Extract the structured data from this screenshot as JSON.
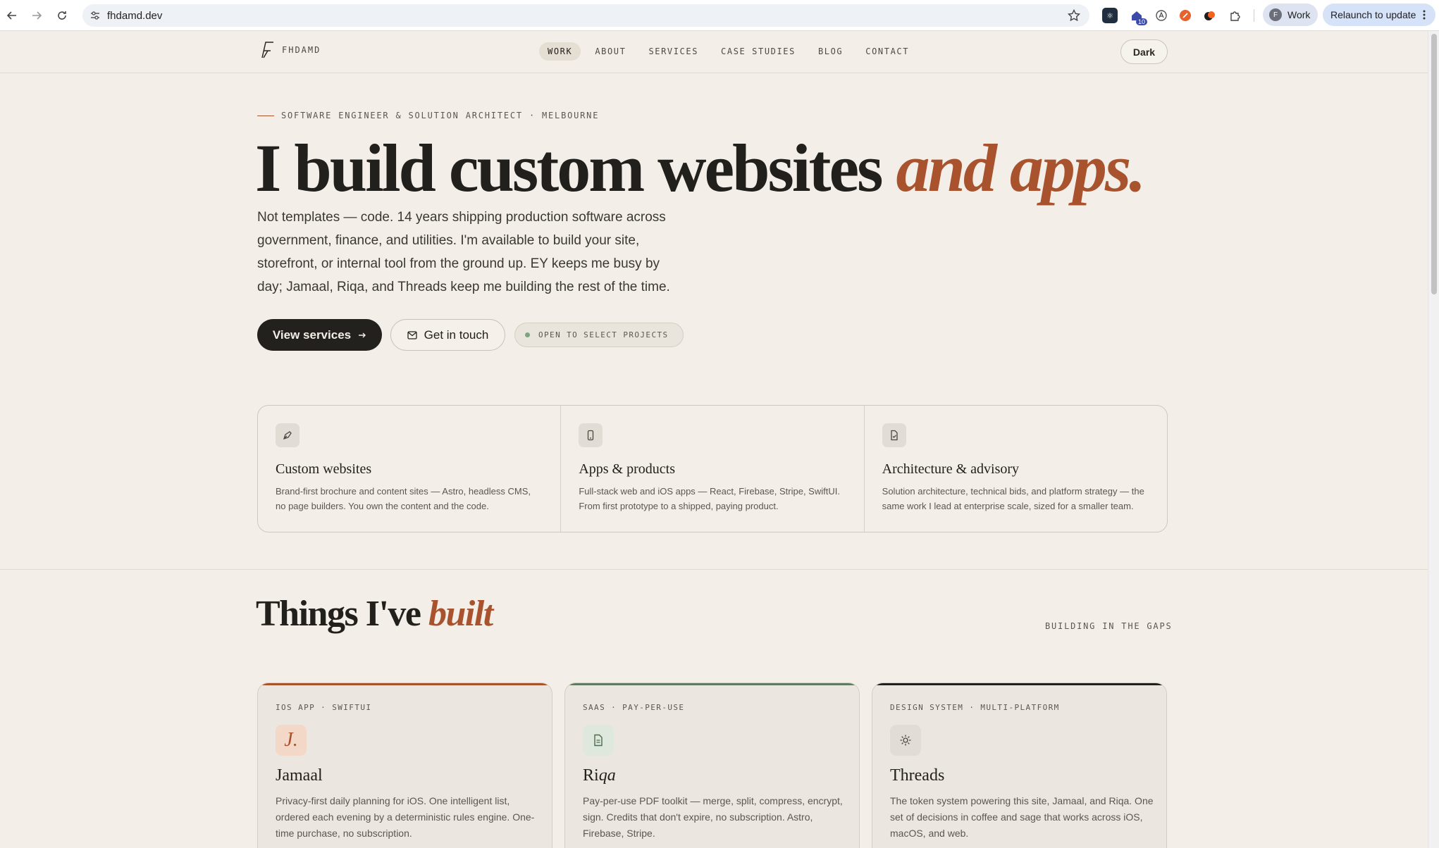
{
  "browser": {
    "url": "fhdamd.dev",
    "extension_badge": "10",
    "profile_initial": "F",
    "profile_label": "Work",
    "relaunch_label": "Relaunch to update"
  },
  "site": {
    "logo_text": "FHDAMD",
    "nav": [
      {
        "label": "WORK",
        "active": true
      },
      {
        "label": "ABOUT"
      },
      {
        "label": "SERVICES"
      },
      {
        "label": "CASE STUDIES"
      },
      {
        "label": "BLOG"
      },
      {
        "label": "CONTACT"
      }
    ],
    "theme_toggle": "Dark"
  },
  "hero": {
    "eyebrow": "SOFTWARE ENGINEER & SOLUTION ARCHITECT · MELBOURNE",
    "title_main": "I build custom websites",
    "title_accent": "and apps.",
    "copy": "Not templates — code. 14 years shipping production software across government, finance, and utilities. I'm available to build your site, storefront, or internal tool from the ground up. EY keeps me busy by day; Jamaal, Riqa, and Threads keep me building the rest of the time.",
    "primary_cta": "View services",
    "secondary_cta": "Get in touch",
    "status": "OPEN TO SELECT PROJECTS"
  },
  "services": [
    {
      "icon": "pen-tool-icon",
      "title": "Custom websites",
      "desc": "Brand-first brochure and content sites — Astro, headless CMS, no page builders. You own the content and the code."
    },
    {
      "icon": "smartphone-icon",
      "title": "Apps & products",
      "desc": "Full-stack web and iOS apps — React, Firebase, Stripe, SwiftUI. From first prototype to a shipped, paying product."
    },
    {
      "icon": "document-check-icon",
      "title": "Architecture & advisory",
      "desc": "Solution architecture, technical bids, and platform strategy — the same work I lead at enterprise scale, sized for a smaller team."
    }
  ],
  "built": {
    "title_main": "Things I've",
    "title_accent": "built",
    "tag": "BUILDING IN THE GAPS",
    "projects": [
      {
        "kicker": "IOS APP · SWIFTUI",
        "glyph": "J.",
        "name": "Jamaal",
        "desc": "Privacy-first daily planning for iOS. One intelligent list, ordered each evening by a deterministic rules engine. One-time purchase, no subscription.",
        "accent": "#a8532e"
      },
      {
        "kicker": "SAAS · PAY-PER-USE",
        "name_plain": "Ri",
        "name_italic": "qa",
        "desc": "Pay-per-use PDF toolkit — merge, split, compress, encrypt, sign. Credits that don't expire, no subscription. Astro, Firebase, Stripe.",
        "accent": "#5e7d60"
      },
      {
        "kicker": "DESIGN SYSTEM · MULTI-PLATFORM",
        "name": "Threads",
        "desc": "The token system powering this site, Jamaal, and Riqa. One set of decisions in coffee and sage that works across iOS, macOS, and web.",
        "accent": "#22201d"
      }
    ]
  },
  "colors": {
    "accent": "#a8532e",
    "sage": "#5e7d60",
    "ink": "#22201d",
    "background": "#f3efe8"
  }
}
